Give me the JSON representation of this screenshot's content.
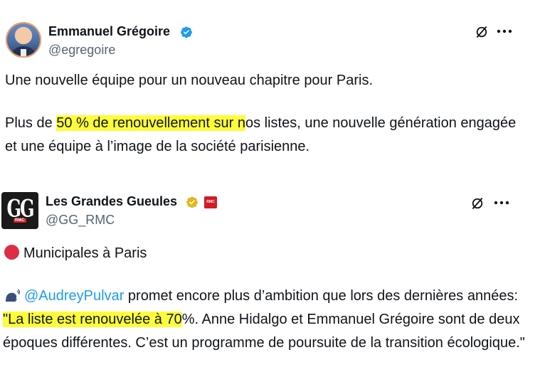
{
  "tweet1": {
    "name": "Emmanuel Grégoire",
    "handle": "@egregoire",
    "text1": "Une nouvelle équipe pour un nouveau chapitre pour Paris.",
    "text2_before": "Plus de ",
    "text2_highlight": "50 % de renouvellement sur n",
    "text2_after": "os listes, une nouvelle génération engagée et une équipe à l’image de la société parisienne."
  },
  "tweet2": {
    "name": "Les Grandes Gueules",
    "handle": "@GG_RMC",
    "logo_text": "GG",
    "logo_sub": "RMC",
    "badge_text": "RMC",
    "line1": "Municipales à Paris",
    "mention": "@AudreyPulvar",
    "text_a": " promet encore plus d’ambition que lors des dernières années: ",
    "text_highlight": "\"La liste est renouvelée à 70",
    "text_b": "%. Anne Hidalgo et Emmanuel Grégoire sont de deux époques différentes. C’est un programme de poursuite de la transition écologique.\""
  },
  "colors": {
    "highlight": "#fdfd3a",
    "link": "#1d9bf0",
    "verified_blue": "#1d9bf0",
    "verified_gold": "#e2b719",
    "secondary_text": "#536471"
  },
  "icons": {
    "verified": "verified-badge-icon",
    "x": "x-logo-icon",
    "more": "more-icon",
    "red_circle": "red-circle-emoji",
    "speaking_head": "speaking-head-emoji"
  }
}
